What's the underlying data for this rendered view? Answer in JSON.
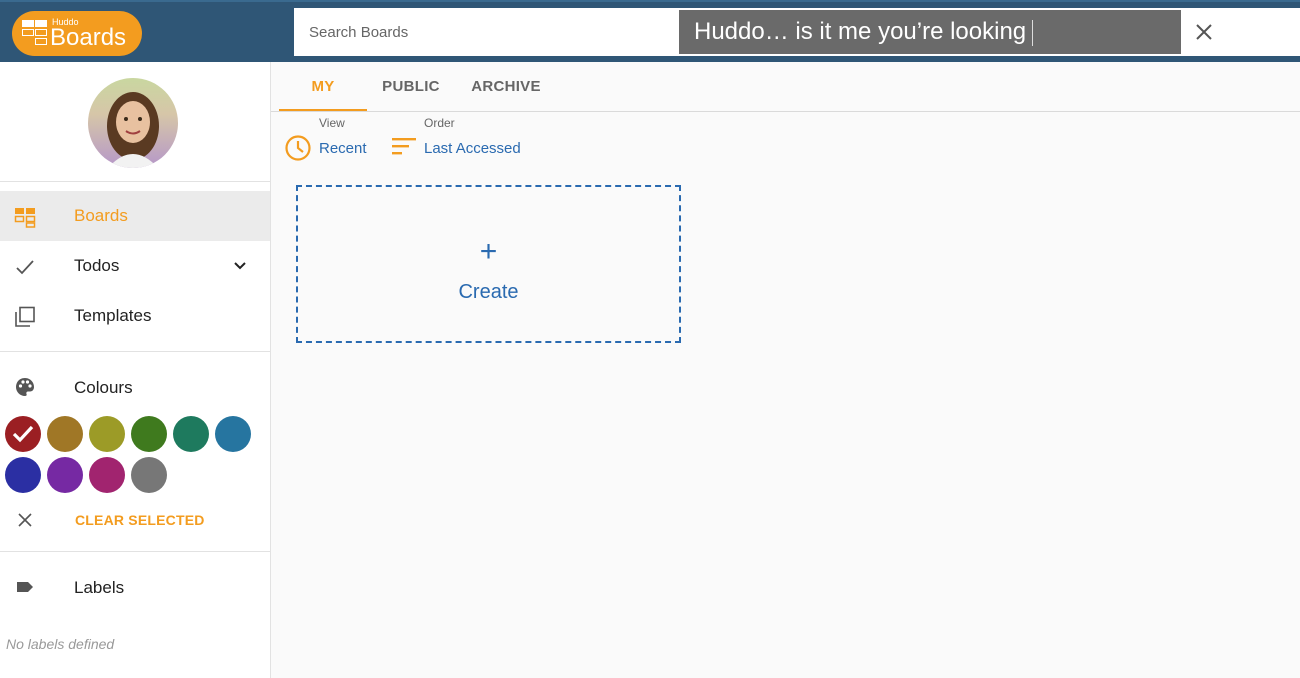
{
  "header": {
    "logo_small": "Huddo",
    "logo_big": "Boards",
    "search_placeholder": "Search Boards",
    "caption_text": "Huddo… is it me you’re looking"
  },
  "tabs": [
    {
      "label": "MY",
      "active": true
    },
    {
      "label": "PUBLIC",
      "active": false
    },
    {
      "label": "ARCHIVE",
      "active": false
    }
  ],
  "controls": {
    "view_caption": "View",
    "view_value": "Recent",
    "order_caption": "Order",
    "order_value": "Last Accessed"
  },
  "create": {
    "plus": "+",
    "label": "Create"
  },
  "sidebar": {
    "nav": [
      {
        "label": "Boards",
        "icon": "boards-icon",
        "active": true
      },
      {
        "label": "Todos",
        "icon": "check-icon",
        "active": false
      },
      {
        "label": "Templates",
        "icon": "templates-icon",
        "active": false
      }
    ],
    "colours_label": "Colours",
    "colours": [
      "#9b1f23",
      "#a07726",
      "#9c9b27",
      "#3f7a1e",
      "#1e7a5e",
      "#2675a0",
      "#2b2fa3",
      "#7629a3",
      "#a1246f",
      "#777777"
    ],
    "selected_colour": "#9b1f23",
    "clear_label": "CLEAR SELECTED",
    "labels_label": "Labels",
    "no_labels": "No labels defined"
  },
  "theme": {
    "accent": "#f39c1f",
    "link": "#2a6ab0",
    "header_bg": "#2f5676"
  }
}
